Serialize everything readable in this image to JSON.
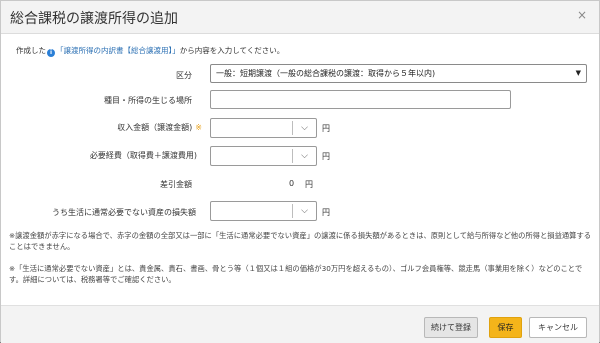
{
  "dialog": {
    "title": "総合課税の譲渡所得の追加",
    "close_glyph": "×"
  },
  "intro": {
    "before": "作成した",
    "link": "「譲渡所得の内訳書【総合譲渡用】」",
    "after": "から内容を入力してください。"
  },
  "fields": {
    "category": {
      "label": "区分",
      "value": "一般：短期譲渡（一般の総合課税の譲渡：取得から５年以内)"
    },
    "place": {
      "label": "種目・所得の生じる場所",
      "value": ""
    },
    "income": {
      "label": "収入金額（譲渡金額)",
      "required_mark": "※",
      "unit": "円"
    },
    "expenses": {
      "label": "必要経費（取得費＋譲渡費用)",
      "unit": "円"
    },
    "difference": {
      "label": "差引金額",
      "value": "0",
      "unit": "円"
    },
    "loss": {
      "label": "うち生活に通常必要でない資産の損失額",
      "unit": "円"
    }
  },
  "notes": [
    "※譲渡金額が赤字になる場合で、赤字の金額の全部又は一部に「生活に通常必要でない資産」の譲渡に係る損失額があるときは、原則として給与所得など他の所得と損益通算することはできません。",
    "※「生活に通常必要でない資産」とは、貴金属、貴石、書画、骨とう等（１個又は１組の価格が30万円を超えるもの）、ゴルフ会員権等、競走馬（事業用を除く）などのことです。詳細については、税務署等でご確認ください。"
  ],
  "buttons": {
    "continue_label": "続けて登録",
    "save_label": "保存",
    "cancel_label": "キャンセル"
  },
  "colors": {
    "save_button": "#f4b41a",
    "link": "#2a6fb3",
    "info_icon": "#2b7fd6",
    "required_mark": "#e8a21d"
  }
}
